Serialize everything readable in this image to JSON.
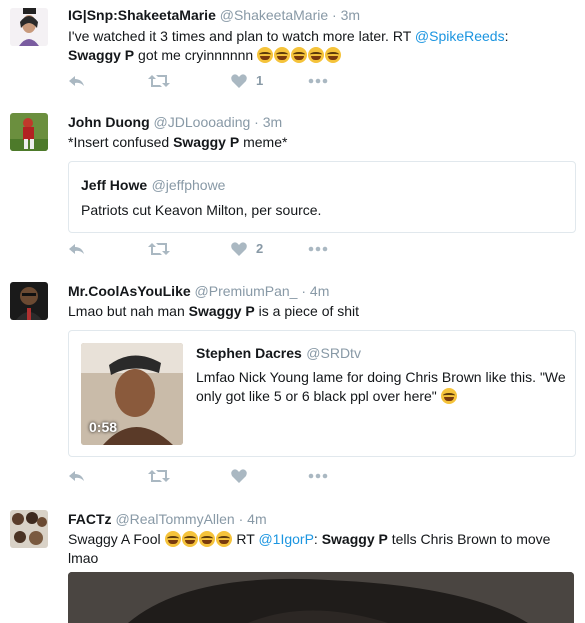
{
  "tweets": [
    {
      "name": "IG|Snp:ShakeetaMarie",
      "handle": "@ShakeetaMarie",
      "sep": "·",
      "time": "3m",
      "text_a": "I've watched it 3 times and plan to watch more later. RT ",
      "mention": "@SpikeReeds",
      "text_b": ":",
      "bold": "Swaggy P",
      "text_c": " got me cryinnnnnn ",
      "likes": "1"
    },
    {
      "name": "John Duong",
      "handle": "@JDLoooading",
      "sep": "·",
      "time": "3m",
      "text_a": "*Insert confused ",
      "bold": "Swaggy P",
      "text_b": " meme*",
      "likes": "2",
      "quote": {
        "name": "Jeff Howe",
        "handle": "@jeffphowe",
        "text": "Patriots cut Keavon Milton, per source."
      }
    },
    {
      "name": "Mr.CoolAsYouLike",
      "handle": "@PremiumPan_",
      "sep": "·",
      "time": "4m",
      "text_a": "Lmao but nah man ",
      "bold": "Swaggy P",
      "text_b": " is a piece of shit",
      "quote": {
        "name": "Stephen Dacres",
        "handle": "@SRDtv",
        "text": "Lmfao Nick Young lame for doing Chris Brown like this. \"We only got like 5 or 6 black ppl over here\"",
        "video_duration": "0:58"
      }
    },
    {
      "name": "FACTz",
      "handle": "@RealTommyAllen",
      "sep": "·",
      "time": "4m",
      "text_a": "Swaggy A Fool ",
      "text_b": " RT ",
      "mention": "@1IgorP",
      "text_c": ": ",
      "bold": "Swaggy P",
      "text_d": " tells Chris Brown to move lmao"
    }
  ],
  "colors": {
    "link": "#1b95e0",
    "muted": "#8899a6",
    "icon": "#aab8c2",
    "border": "#e1e8ed"
  },
  "icons": [
    "reply-icon",
    "retweet-icon",
    "like-icon",
    "more-icon",
    "emoji-tears-of-joy",
    "emoji-crying"
  ]
}
